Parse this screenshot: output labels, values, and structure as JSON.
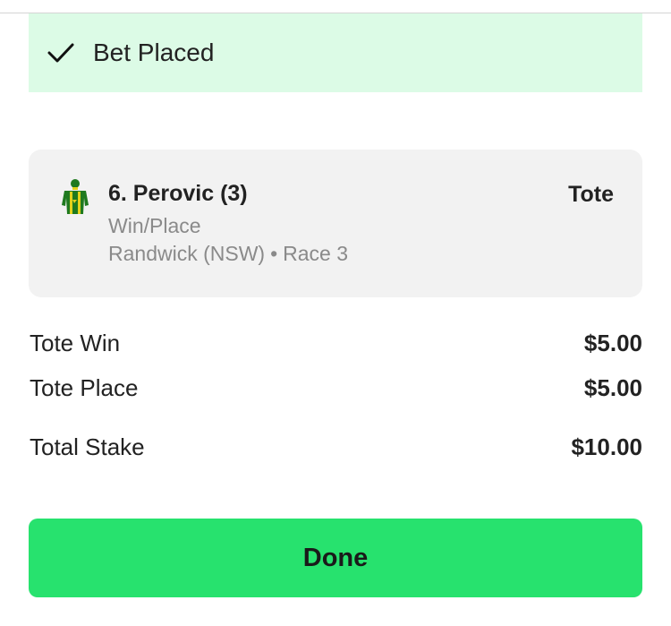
{
  "banner": {
    "icon": "checkmark-icon",
    "text": "Bet Placed",
    "background": "#dcfbe6"
  },
  "bet": {
    "silks_icon": "jockey-silks-icon",
    "silks_colors": [
      "#1f7a1f",
      "#e3d21a"
    ],
    "runner": "6. Perovic (3)",
    "bet_type": "Win/Place",
    "venue": "Randwick (NSW)",
    "separator": "•",
    "race": "Race 3",
    "pool": "Tote"
  },
  "summary": {
    "win_label": "Tote Win",
    "win_value": "$5.00",
    "place_label": "Tote Place",
    "place_value": "$5.00",
    "total_label": "Total Stake",
    "total_value": "$10.00"
  },
  "actions": {
    "done_label": "Done",
    "done_color": "#27e26e"
  }
}
